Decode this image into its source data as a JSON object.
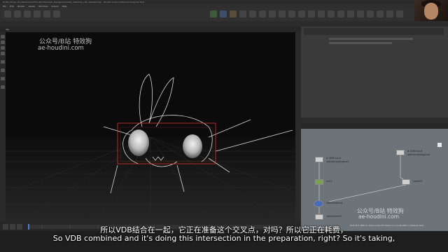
{
  "window": {
    "title": "D:/My_Drive/_Houdini/School/FX/4-09 Character_Design/character_sketches_vdb_intersect.hip - Houdini Indie Limited-Commercial 19.5"
  },
  "menu": [
    "File",
    "Edit",
    "Render",
    "Assets",
    "Windows",
    "Solaris",
    "Help"
  ],
  "viewport": {
    "path_label": "obj",
    "watermark_line1": "公众号/B站 特效狗",
    "watermark_line2": "ae-houdini.com"
  },
  "network": {
    "watermark_line1": "公众号/B站 特效狗",
    "watermark_line2": "ae-houdini.com",
    "nodes": [
      {
        "name": "A VDB input",
        "sub": "vdbfrompolygons1"
      },
      {
        "name": "B VDB input",
        "sub": "vdbfrompolygons2"
      },
      {
        "name": "null1",
        "sub": ""
      },
      {
        "name": "switch5",
        "sub": ""
      },
      {
        "name": "vdbcombine1",
        "sub": ""
      },
      {
        "name": "vdbconvert1",
        "sub": ""
      }
    ],
    "note": "Hold B or Path to show node info  Press on a node after a network wire"
  },
  "subtitles": {
    "chinese": "所以VDB结合在一起，它正在准备这个交叉点，对吗？所以它正在耗费，",
    "english": "So VDB combined and it's doing this intersection in the preparation, right? So it's taking,"
  },
  "colors": {
    "accent": "#e03030",
    "network_bg": "#6c7379"
  }
}
